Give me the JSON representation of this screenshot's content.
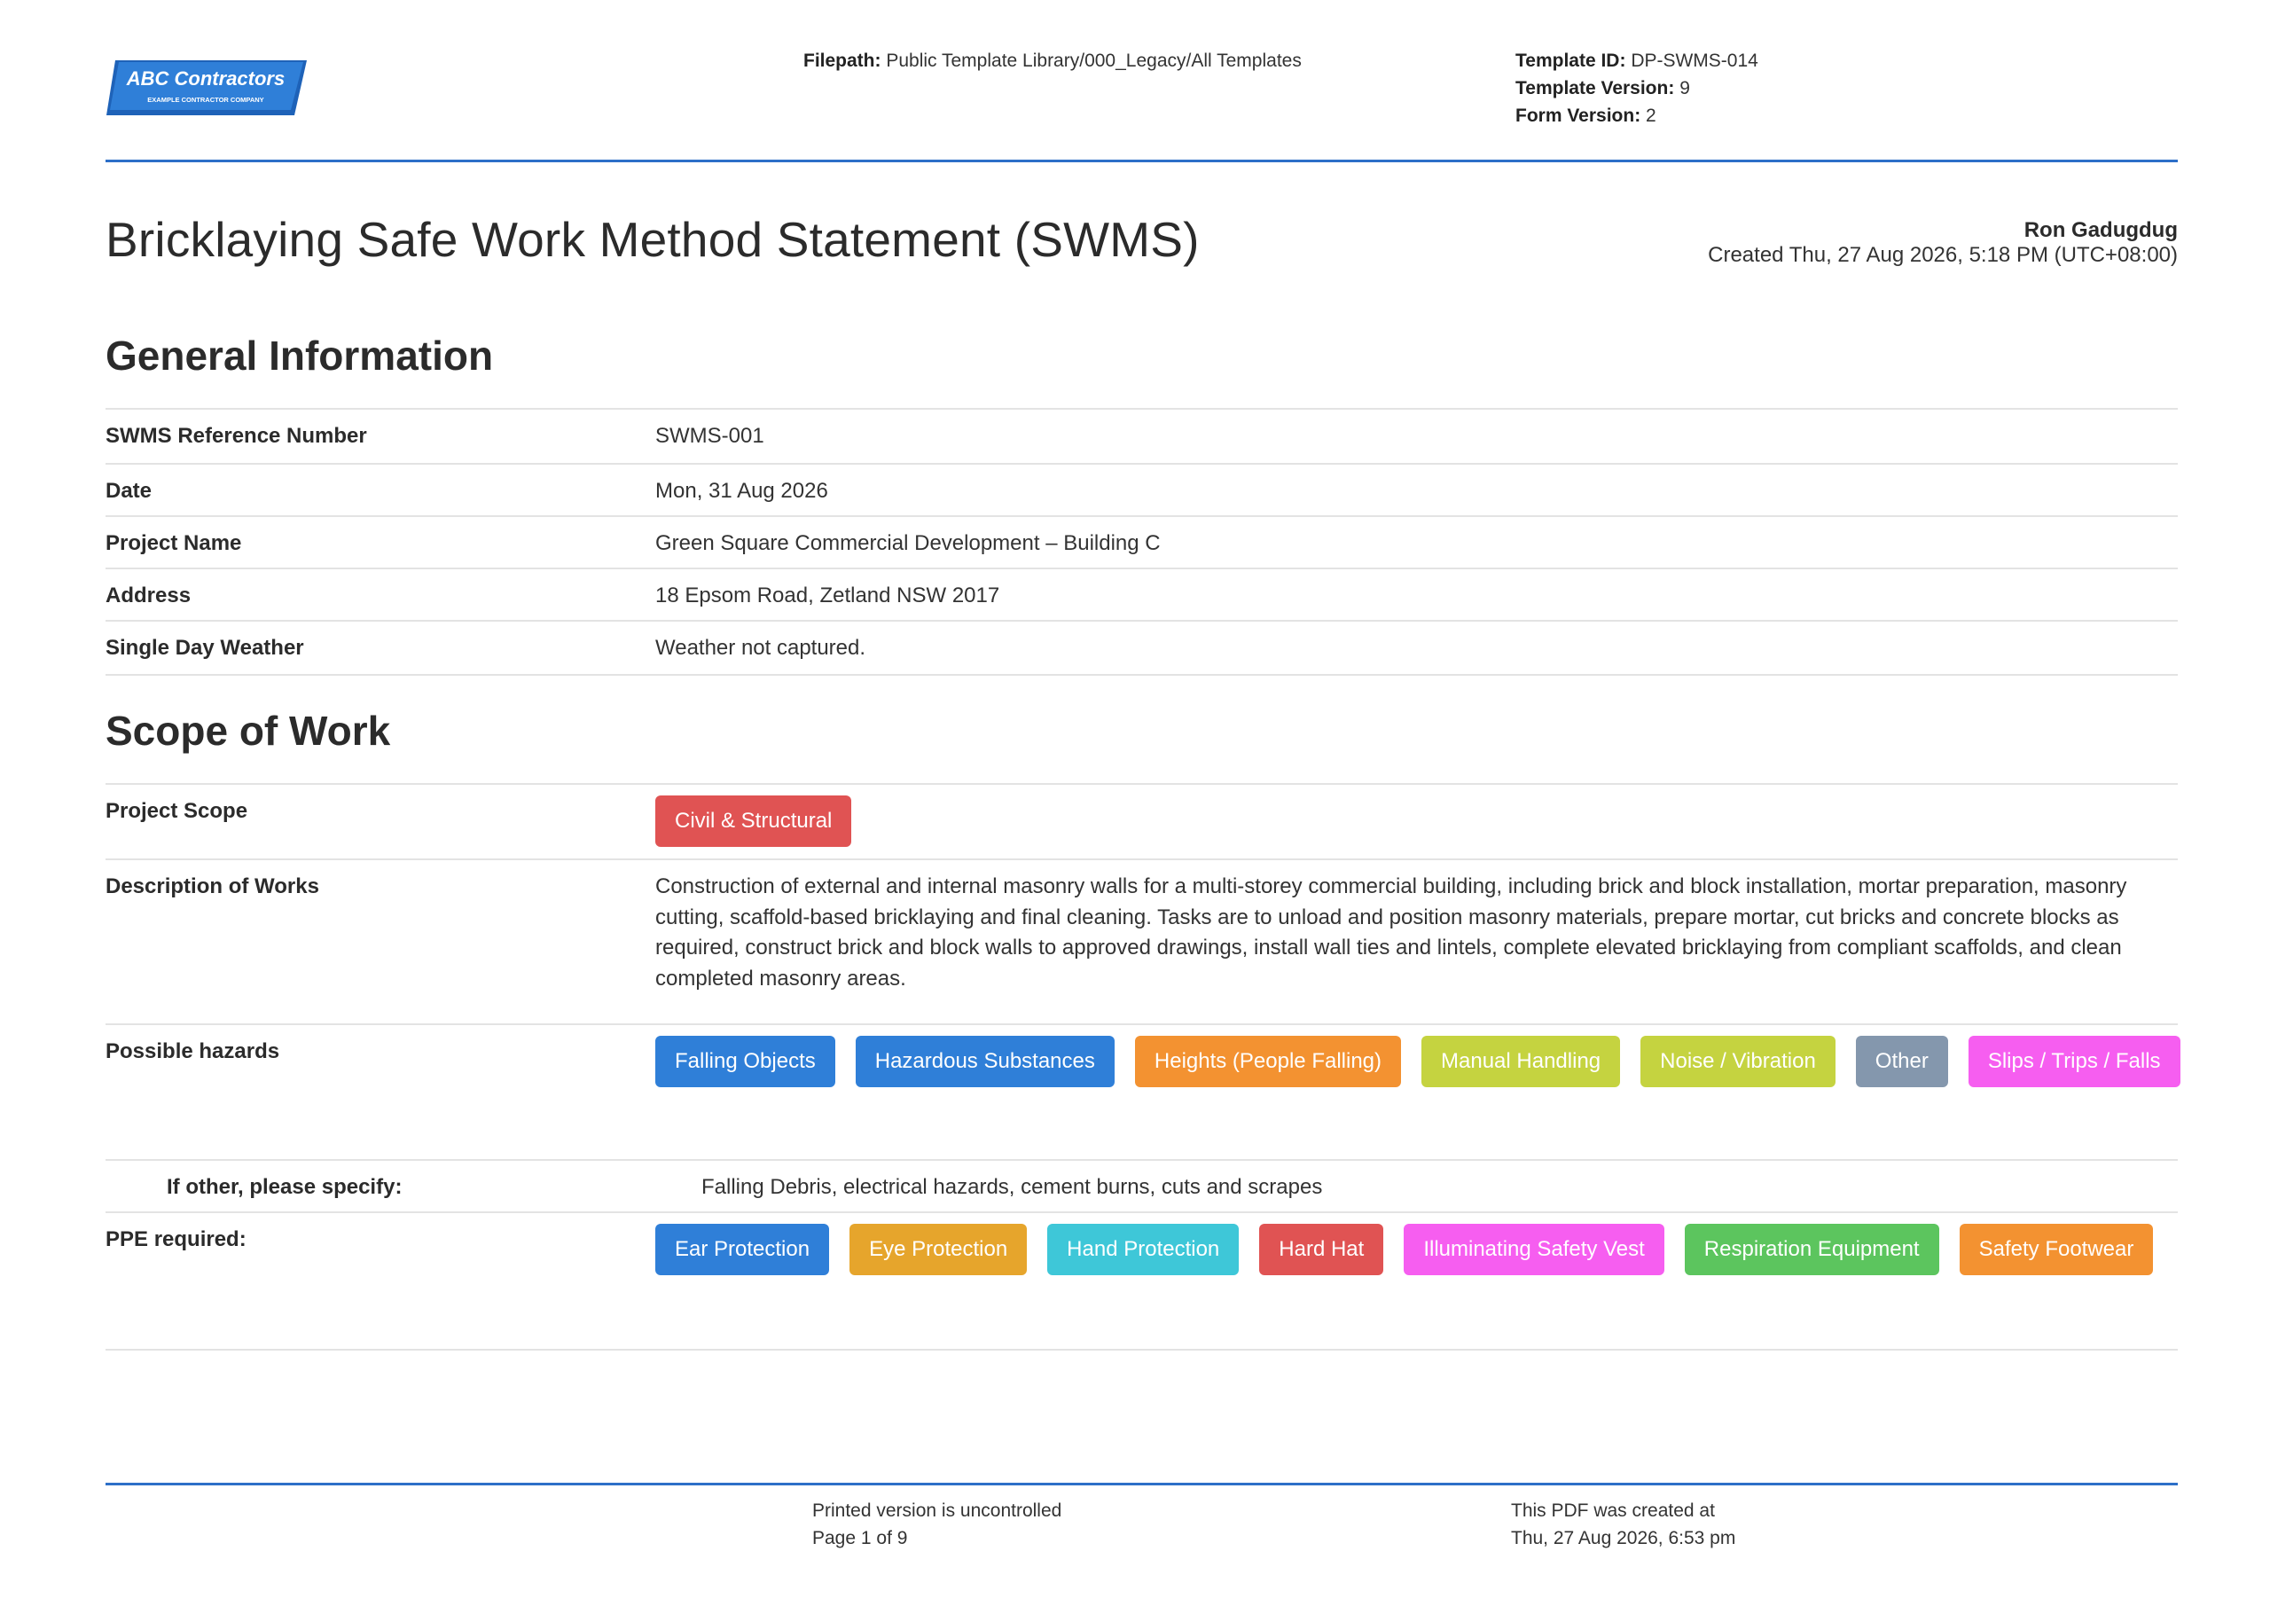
{
  "header": {
    "logo": {
      "name": "ABC Contractors",
      "tagline": "EXAMPLE CONTRACTOR COMPANY",
      "color": "#2f7fd8"
    },
    "filepath_label": "Filepath:",
    "filepath_value": "Public Template Library/000_Legacy/All Templates",
    "template_id_label": "Template ID:",
    "template_id_value": "DP-SWMS-014",
    "template_version_label": "Template Version:",
    "template_version_value": "9",
    "form_version_label": "Form Version:",
    "form_version_value": "2"
  },
  "document": {
    "title": "Bricklaying Safe Work Method Statement (SWMS)",
    "author": "Ron Gadugdug",
    "created": "Created Thu, 27 Aug 2026, 5:18 PM (UTC+08:00)"
  },
  "general_information": {
    "heading": "General Information",
    "rows": [
      {
        "label": "SWMS Reference Number",
        "value": "SWMS-001"
      },
      {
        "label": "Date",
        "value": "Mon, 31 Aug 2026"
      },
      {
        "label": "Project Name",
        "value": "Green Square Commercial Development – Building C"
      },
      {
        "label": "Address",
        "value": "18 Epsom Road, Zetland NSW 2017"
      },
      {
        "label": "Single Day Weather",
        "value": "Weather not captured."
      }
    ]
  },
  "scope_of_work": {
    "heading": "Scope of Work",
    "project_scope_label": "Project Scope",
    "project_scope_tags": [
      {
        "label": "Civil & Structural",
        "color": "#e05353"
      }
    ],
    "description_label": "Description of Works",
    "description": "Construction of external and internal masonry walls for a multi-storey commercial building, including brick and block installation, mortar preparation, masonry cutting, scaffold-based bricklaying and final cleaning. Tasks are to unload and position masonry materials, prepare mortar, cut bricks and concrete blocks as required, construct brick and block walls to approved drawings, install wall ties and lintels, complete elevated bricklaying from compliant scaffolds, and clean completed masonry areas.",
    "hazards_label": "Possible hazards",
    "hazards": [
      {
        "label": "Falling Objects",
        "color": "#2f7fd8"
      },
      {
        "label": "Hazardous Substances",
        "color": "#2f7fd8"
      },
      {
        "label": "Heights (People Falling)",
        "color": "#f39231"
      },
      {
        "label": "Manual Handling",
        "color": "#c5d340"
      },
      {
        "label": "Noise / Vibration",
        "color": "#c5d340"
      },
      {
        "label": "Other",
        "color": "#8497ad"
      },
      {
        "label": "Slips / Trips / Falls",
        "color": "#f65ef0"
      }
    ],
    "other_label": "If other, please specify:",
    "other_value": "Falling Debris, electrical hazards, cement burns, cuts and scrapes",
    "ppe_label": "PPE required:",
    "ppe": [
      {
        "label": "Ear Protection",
        "color": "#2f7fd8"
      },
      {
        "label": "Eye Protection",
        "color": "#e6a52c"
      },
      {
        "label": "Hand Protection",
        "color": "#3ec7d8"
      },
      {
        "label": "Hard Hat",
        "color": "#e05353"
      },
      {
        "label": "Illuminating Safety Vest",
        "color": "#f65ef0"
      },
      {
        "label": "Respiration Equipment",
        "color": "#5cc55e"
      },
      {
        "label": "Safety Footwear",
        "color": "#f39231"
      }
    ]
  },
  "footer": {
    "uncontrolled": "Printed version is uncontrolled",
    "page": "Page 1 of 9",
    "created_label": "This PDF was created at",
    "created_value": "Thu, 27 Aug 2026, 6:53 pm"
  }
}
